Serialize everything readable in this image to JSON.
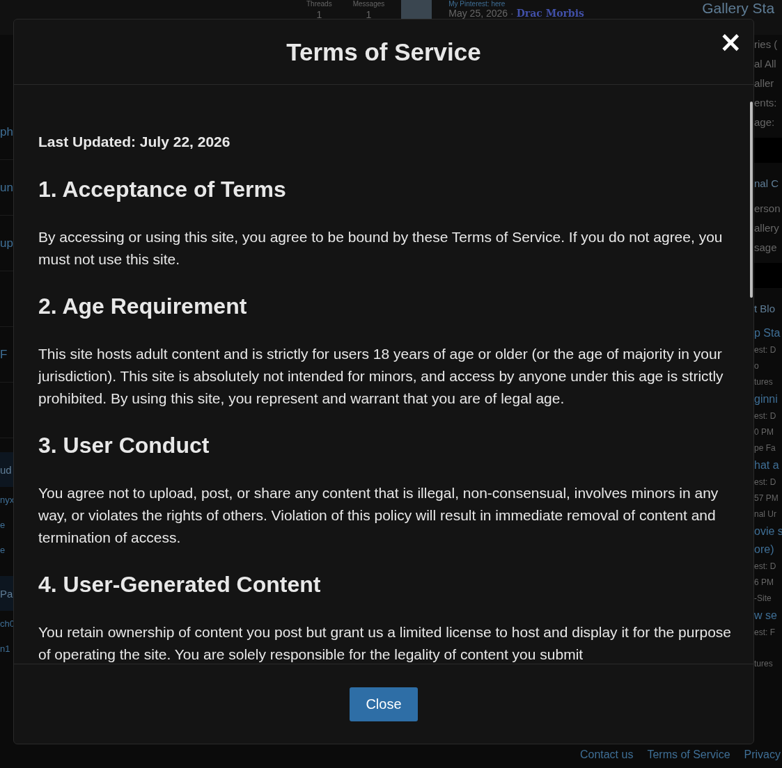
{
  "background": {
    "top_stats": [
      {
        "label": "Threads",
        "value": "1"
      },
      {
        "label": "Messages",
        "value": "1"
      }
    ],
    "latest_thread": {
      "title": "My Pinterest: here",
      "date": "May 25, 2026 ·",
      "author": "Drac Morbis"
    },
    "sidebar_heading": "Gallery Sta",
    "sidebar_fragments": [
      {
        "kind": "text",
        "text": "ries ("
      },
      {
        "kind": "text",
        "text": "al All"
      },
      {
        "kind": "text",
        "text": "aller"
      },
      {
        "kind": "text",
        "text": "ents:"
      },
      {
        "kind": "text",
        "text": "age:"
      },
      {
        "kind": "band"
      },
      {
        "kind": "title",
        "text": "nal C"
      },
      {
        "kind": "text",
        "text": "erson"
      },
      {
        "kind": "text",
        "text": "allery"
      },
      {
        "kind": "text",
        "text": "sage"
      },
      {
        "kind": "band"
      },
      {
        "kind": "title",
        "text": "t Blo"
      },
      {
        "kind": "link",
        "text": "p Sta"
      },
      {
        "kind": "small",
        "text": "est: D"
      },
      {
        "kind": "small",
        "text": "o"
      },
      {
        "kind": "small",
        "text": "tures"
      },
      {
        "kind": "link",
        "text": "ginni"
      },
      {
        "kind": "small",
        "text": "est: D"
      },
      {
        "kind": "small",
        "text": "0 PM"
      },
      {
        "kind": "small",
        "text": "pe Fa"
      },
      {
        "kind": "link",
        "text": "hat a"
      },
      {
        "kind": "small",
        "text": "est: D"
      },
      {
        "kind": "small",
        "text": "57 PM"
      },
      {
        "kind": "small",
        "text": "nal Ur"
      },
      {
        "kind": "link",
        "text": "ovie s"
      },
      {
        "kind": "link",
        "text": "ore)"
      },
      {
        "kind": "small",
        "text": "est: D"
      },
      {
        "kind": "small",
        "text": "6 PM"
      },
      {
        "kind": "small",
        "text": "-Site"
      },
      {
        "kind": "link",
        "text": "w se"
      },
      {
        "kind": "small",
        "text": "est: F"
      },
      {
        "kind": "gap"
      },
      {
        "kind": "small",
        "text": "tures"
      }
    ],
    "left_fragments": [
      {
        "kind": "row",
        "text": "ph"
      },
      {
        "kind": "row",
        "text": "un"
      },
      {
        "kind": "row",
        "text": "up"
      },
      {
        "kind": "row"
      },
      {
        "kind": "row",
        "text": "F"
      },
      {
        "kind": "row"
      },
      {
        "kind": "title",
        "text": "ud"
      },
      {
        "kind": "small",
        "text": "nyx"
      },
      {
        "kind": "small",
        "text": "e"
      },
      {
        "kind": "small",
        "text": "e"
      },
      {
        "kind": "title",
        "text": "Pa"
      },
      {
        "kind": "small",
        "text": "ch0"
      },
      {
        "kind": "small",
        "text": "n1"
      }
    ],
    "footer_links": [
      "Contact us",
      "Terms of Service",
      "Privacy"
    ]
  },
  "modal": {
    "title": "Terms of Service",
    "close_icon": "×",
    "last_updated": "Last Updated: July 22, 2026",
    "sections": [
      {
        "heading": "1. Acceptance of Terms",
        "body": "By accessing or using this site, you agree to be bound by these Terms of Service. If you do not agree, you must not use this site."
      },
      {
        "heading": "2. Age Requirement",
        "body": "This site hosts adult content and is strictly for users 18 years of age or older (or the age of majority in your jurisdiction). This site is absolutely not intended for minors, and access by anyone under this age is strictly prohibited. By using this site, you represent and warrant that you are of legal age."
      },
      {
        "heading": "3. User Conduct",
        "body": "You agree not to upload, post, or share any content that is illegal, non-consensual, involves minors in any way, or violates the rights of others. Violation of this policy will result in immediate removal of content and termination of access."
      },
      {
        "heading": "4. User-Generated Content",
        "body": "You retain ownership of content you post but grant us a limited license to host and display it for the purpose of operating the site. You are solely responsible for the legality of content you submit"
      }
    ],
    "button": "Close"
  }
}
